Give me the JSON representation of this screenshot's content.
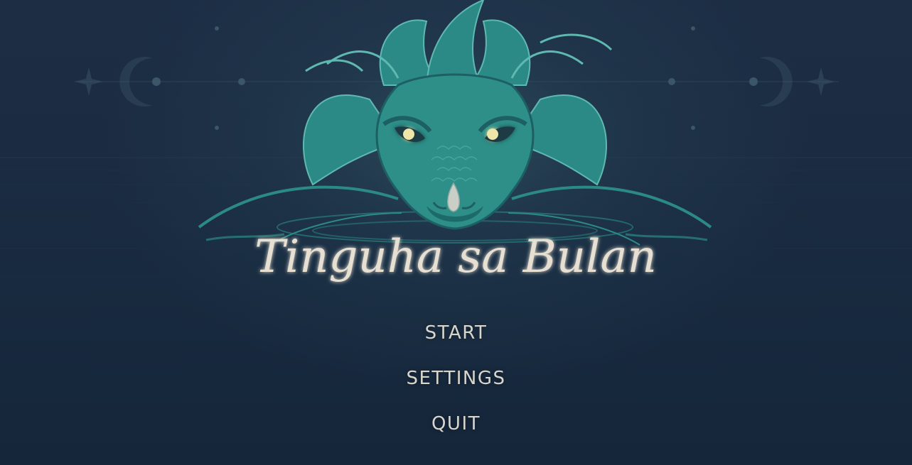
{
  "game": {
    "title": "Tinguha sa Bulan"
  },
  "menu": {
    "items": [
      {
        "label": "START"
      },
      {
        "label": "SETTINGS"
      },
      {
        "label": "QUIT"
      }
    ]
  },
  "colors": {
    "background": "#1b2b40",
    "dragon": "#2c8a86",
    "dragon_dark": "#1d5f63",
    "eyes": "#f0e6a8",
    "text": "#d8d6cc"
  }
}
